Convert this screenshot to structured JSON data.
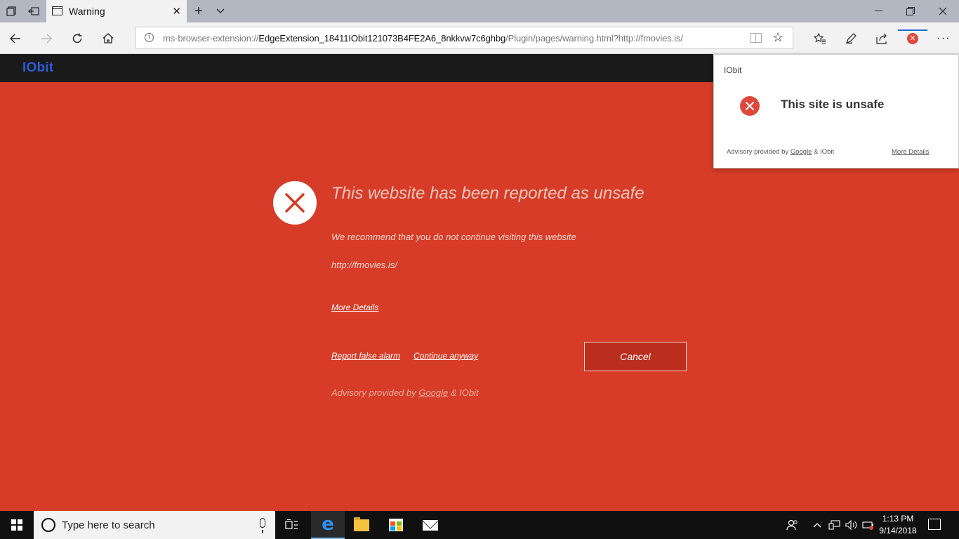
{
  "browser": {
    "tab_title": "Warning",
    "address_prefix": "ms-browser-extension://",
    "address_highlight": "EdgeExtension_18411IObit121073B4FE2A6_8nkkvw7c6ghbg",
    "address_suffix": "/Plugin/pages/warning.html?http://fmovies.is/"
  },
  "page": {
    "logo": "IObit",
    "warning_title": "This website has been reported as unsafe",
    "warning_subtitle": "We recommend that you do not continue visiting this website",
    "site_url": "http://fmovies.is/",
    "more_details": "More Details",
    "report_false_alarm": "Report false alarm",
    "continue_anyway": "Continue anyway",
    "cancel": "Cancel",
    "advisory_prefix": "Advisory provided by ",
    "advisory_google": "Google",
    "advisory_suffix": " & IObit"
  },
  "popup": {
    "brand": "IObit",
    "status": "This site is unsafe",
    "advisory_prefix": "Advisory provided by ",
    "advisory_google": "Google",
    "advisory_suffix": " & IObit",
    "more_details": "More Details"
  },
  "taskbar": {
    "search_placeholder": "Type here to search",
    "time": "1:13 PM",
    "date": "9/14/2018"
  },
  "colors": {
    "page_background": "#d63c27",
    "header_background": "#1a1a1a",
    "logo": "#2f5bd9",
    "danger_icon": "#e0483c",
    "cancel_button": "#bb2d1d"
  },
  "icons": [
    "tab-actions-icon",
    "back-tab-icon",
    "page-icon",
    "close-icon",
    "new-tab-icon",
    "chevron-down-icon",
    "minimize-icon",
    "restore-icon",
    "back-icon",
    "forward-icon",
    "refresh-icon",
    "home-icon",
    "info-icon",
    "reading-view-icon",
    "star-icon",
    "favorites-icon",
    "pen-icon",
    "share-icon",
    "iobit-extension-icon",
    "more-icon",
    "windows-icon",
    "cortana-icon",
    "microphone-icon",
    "task-view-icon",
    "edge-icon",
    "file-explorer-icon",
    "store-icon",
    "mail-icon",
    "people-icon",
    "chevron-up-icon",
    "network-icon",
    "volume-icon",
    "battery-icon",
    "notifications-icon"
  ]
}
